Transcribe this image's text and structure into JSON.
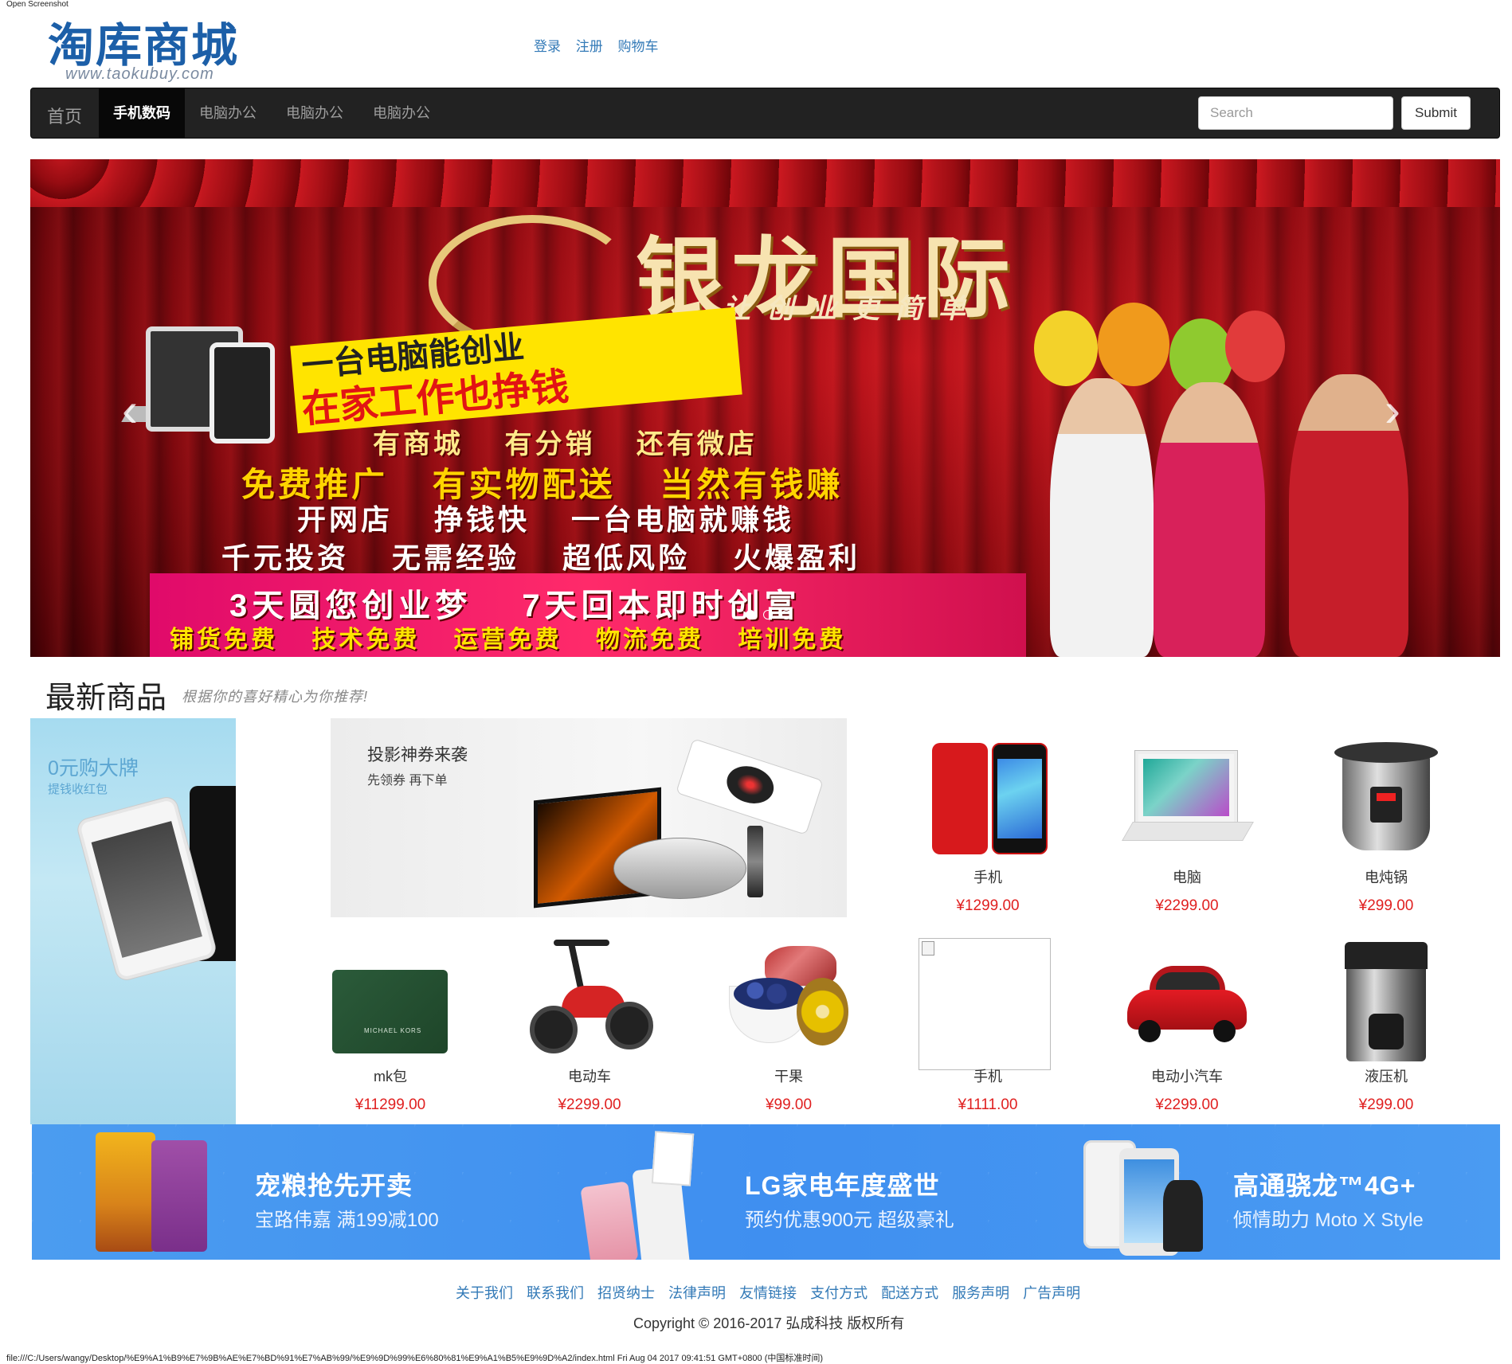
{
  "print": {
    "header": "Open Screenshot",
    "footer": "file:///C:/Users/wangy/Desktop/%E9%A1%B9%E7%9B%AE%E7%BD%91%E7%AB%99/%E9%9D%99%E6%80%81%E9%A1%B5%E9%9D%A2/index.html Fri Aug 04 2017 09:41:51 GMT+0800 (中国标准时间)"
  },
  "logo": {
    "main": "淘库商城",
    "sub": "www.taokubuy.com"
  },
  "top_links": [
    "登录",
    "注册",
    "购物车"
  ],
  "navbar": {
    "brand": "首页",
    "items": [
      {
        "label": "手机数码",
        "active": true
      },
      {
        "label": "电脑办公",
        "active": false
      },
      {
        "label": "电脑办公",
        "active": false
      },
      {
        "label": "电脑办公",
        "active": false
      }
    ],
    "search_placeholder": "Search",
    "submit_label": "Submit"
  },
  "banner": {
    "title": "银龙国际",
    "subtitle": "让创业更简单",
    "line1": "一台电脑能创业",
    "line2": "在家工作也挣钱",
    "row3": "有商城 有分销 还有微店",
    "row4": "免费推广 有实物配送 当然有钱赚",
    "row5": "开网店 挣钱快 一台电脑就赚钱",
    "row6": "千元投资 无需经验 超低风险 火爆盈利",
    "row7": "3天圆您创业梦 7天回本即时创富",
    "row8": "铺货免费 技术免费 运营免费 物流免费 培训免费",
    "prev_arrow": "‹",
    "next_arrow": "›",
    "slides": 3,
    "active_slide": 1
  },
  "section": {
    "title": "最新商品",
    "slogan": "根据你的喜好精心为你推荐!"
  },
  "left_ad": {
    "title": "0元购大牌",
    "subtitle": "提钱收红包"
  },
  "projector_ad": {
    "title": "投影神券来袭",
    "subtitle": "先领券 再下单"
  },
  "products": [
    {
      "name": "手机",
      "price": "¥1299.00",
      "icon": "iphone"
    },
    {
      "name": "电脑",
      "price": "¥2299.00",
      "icon": "laptop"
    },
    {
      "name": "电炖锅",
      "price": "¥299.00",
      "icon": "pressure-cooker"
    },
    {
      "name": "mk包",
      "price": "¥11299.00",
      "icon": "wallet"
    },
    {
      "name": "电动车",
      "price": "¥2299.00",
      "icon": "scooter"
    },
    {
      "name": "干果",
      "price": "¥99.00",
      "icon": "fruit"
    },
    {
      "name": "手机",
      "price": "¥1111.00",
      "icon": "broken-image"
    },
    {
      "name": "电动小汽车",
      "price": "¥2299.00",
      "icon": "car"
    },
    {
      "name": "液压机",
      "price": "¥299.00",
      "icon": "coffee-machine"
    }
  ],
  "wallet_brand": "MICHAEL KORS",
  "bottom_banner": [
    {
      "title": "宠粮抢先开卖",
      "subtitle": "宝路伟嘉  满199减100"
    },
    {
      "title": "LG家电年度盛世",
      "subtitle": "预约优惠900元  超级豪礼"
    },
    {
      "title": "高通骁龙™4G+",
      "subtitle": "倾情助力  Moto X Style"
    }
  ],
  "footer": {
    "links": [
      "关于我们",
      "联系我们",
      "招贤纳士",
      "法律声明",
      "友情链接",
      "支付方式",
      "配送方式",
      "服务声明",
      "广告声明"
    ],
    "copyright": "Copyright © 2016-2017 弘成科技 版权所有"
  },
  "colors": {
    "link": "#337ab7",
    "price": "#e02020",
    "navbar": "#222222",
    "logo": "#1c5fa8",
    "bottom_banner": "#3f8ff0"
  }
}
